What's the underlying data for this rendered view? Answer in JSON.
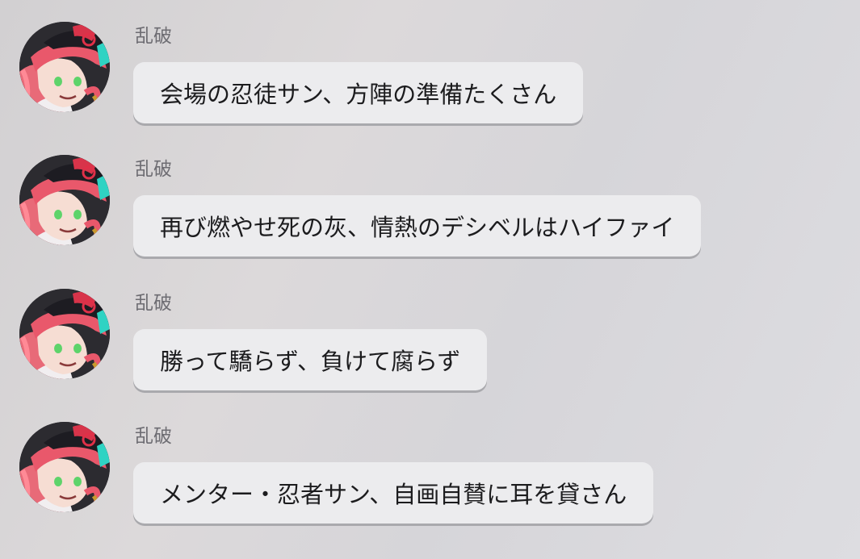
{
  "messages": [
    {
      "sender": "乱破",
      "text": "会場の忍徒サン、方陣の準備たくさん"
    },
    {
      "sender": "乱破",
      "text": "再び燃やせ死の灰、情熱のデシベルはハイファイ"
    },
    {
      "sender": "乱破",
      "text": "勝って驕らず、負けて腐らず"
    },
    {
      "sender": "乱破",
      "text": "メンター・忍者サン、自画自賛に耳を貸さん"
    }
  ],
  "icons": {
    "avatar": "character-avatar"
  }
}
